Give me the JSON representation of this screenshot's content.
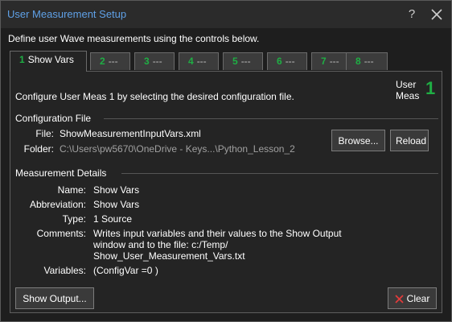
{
  "window": {
    "title": "User Measurement Setup",
    "help_symbol": "?"
  },
  "intro": "Define user Wave measurements using the controls below.",
  "tabs": [
    {
      "number": "1",
      "label": "Show Vars",
      "active": true
    },
    {
      "number": "2",
      "label": "---",
      "active": false
    },
    {
      "number": "3",
      "label": "---",
      "active": false
    },
    {
      "number": "4",
      "label": "---",
      "active": false
    },
    {
      "number": "5",
      "label": "---",
      "active": false
    },
    {
      "number": "6",
      "label": "---",
      "active": false
    },
    {
      "number": "7",
      "label": "---",
      "active": false
    },
    {
      "number": "8",
      "label": "---",
      "active": false
    }
  ],
  "panel": {
    "configure_text": "Configure User Meas 1 by selecting the desired configuration file.",
    "user_meas_label_line1": "User",
    "user_meas_label_line2": "Meas",
    "user_meas_number": "1"
  },
  "config_file": {
    "header": "Configuration File",
    "file_label": "File:",
    "file_value": "ShowMeasurementInputVars.xml",
    "folder_label": "Folder:",
    "folder_value": "C:\\Users\\pw5670\\OneDrive - Keys...\\Python_Lesson_2",
    "browse_label": "Browse...",
    "reload_label": "Reload"
  },
  "details": {
    "header": "Measurement Details",
    "name_label": "Name:",
    "name_value": "Show Vars",
    "abbrev_label": "Abbreviation:",
    "abbrev_value": "Show Vars",
    "type_label": "Type:",
    "type_value": "1 Source",
    "comments_label": "Comments:",
    "comments_value": "Writes input variables and their values to the Show Output window and to the file: c:/Temp/ Show_User_Measurement_Vars.txt",
    "variables_label": "Variables:",
    "variables_value": "(ConfigVar =0 )"
  },
  "footer": {
    "show_output_label": "Show Output...",
    "clear_label": "Clear"
  },
  "colors": {
    "accent_green": "#1fae44",
    "title_blue": "#5fa0e6",
    "clear_red": "#e23b3b"
  }
}
